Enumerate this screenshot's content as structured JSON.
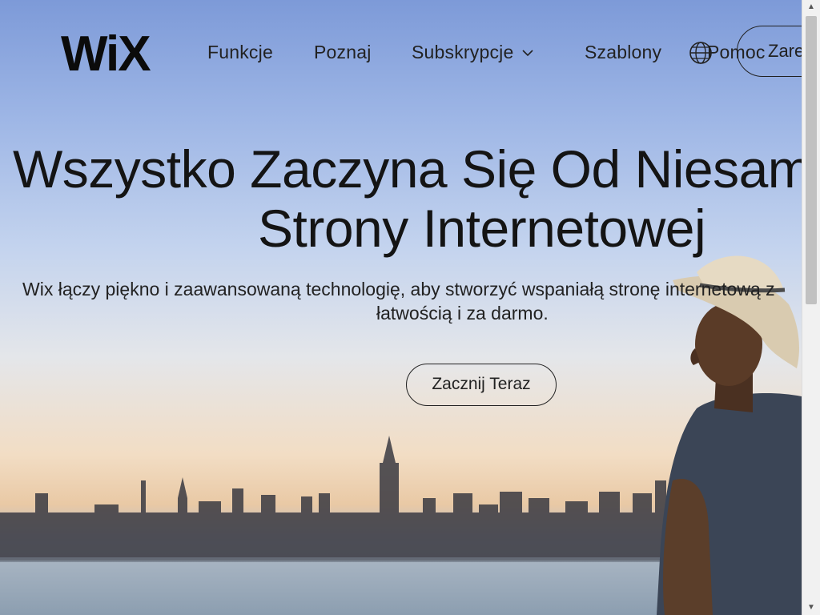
{
  "header": {
    "logo_text": "WiX",
    "nav": {
      "funkcje": "Funkcje",
      "poznaj": "Poznaj",
      "subskrypcje": "Subskrypcje",
      "szablony": "Szablony",
      "pomoc": "Pomoc"
    },
    "signup_label": "Zarejestruj"
  },
  "hero": {
    "title_line1": "Wszystko Zaczyna Się Od Niesamowitej",
    "title_line2": "Strony Internetowej",
    "subtitle_line1": "Wix łączy piękno i zaawansowaną technologię, aby stworzyć wspaniałą stronę internetową z",
    "subtitle_line2": "łatwością i za darmo.",
    "cta_label": "Zacznij Teraz"
  },
  "icons": {
    "globe": "globe-icon",
    "chevron": "chevron-down-icon"
  },
  "colors": {
    "text": "#1a1a1a",
    "sky_top": "#7d9ad8",
    "sky_horizon": "#f2ddc4"
  }
}
